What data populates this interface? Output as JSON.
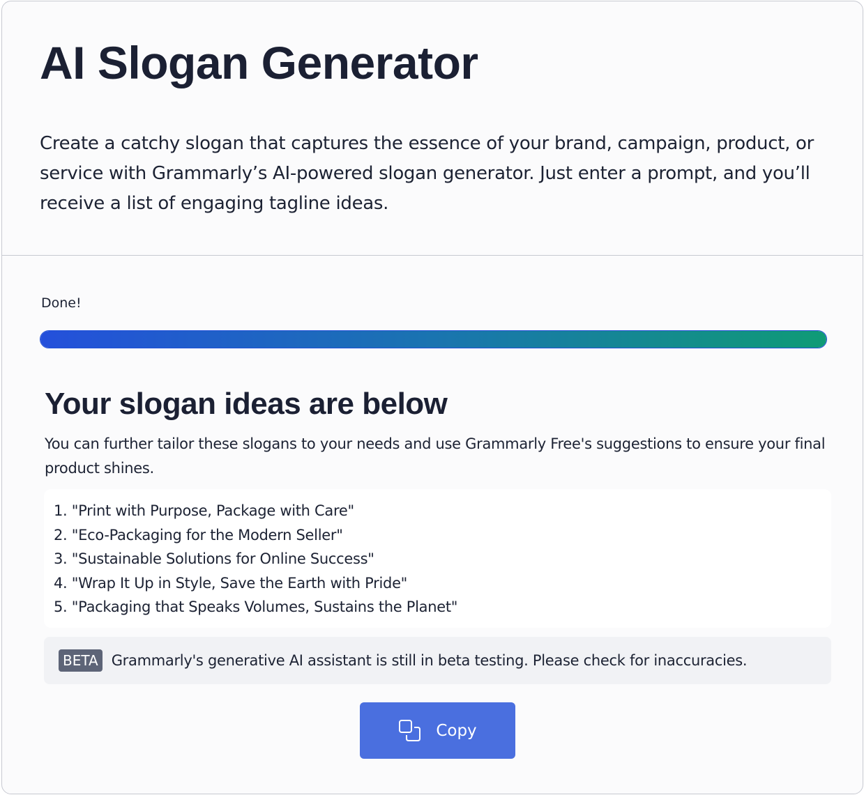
{
  "header": {
    "title": "AI Slogan Generator",
    "intro": "Create a catchy slogan that captures the essence of your brand, campaign, product, or service with Grammarly’s AI-powered slogan generator. Just enter a prompt, and you’ll receive a list of engaging tagline ideas."
  },
  "progress": {
    "status": "Done!",
    "percent": 100,
    "gradient_start": "#2450db",
    "gradient_end": "#0f9b76"
  },
  "results": {
    "title": "Your slogan ideas are below",
    "description": "You can further tailor these slogans to your needs and use Grammarly Free's suggestions to ensure your final product shines.",
    "slogans": [
      "1. \"Print with Purpose, Package with Care\"",
      "2. \"Eco-Packaging for the Modern Seller\"",
      "3. \"Sustainable Solutions for Online Success\"",
      "4. \"Wrap It Up in Style, Save the Earth with Pride\"",
      "5. \"Packaging that Speaks Volumes, Sustains the Planet\""
    ]
  },
  "beta": {
    "badge": "BETA",
    "text": "Grammarly's generative AI assistant is still in beta testing. Please check for inaccuracies."
  },
  "actions": {
    "copy_label": "Copy",
    "copy_icon": "copy-icon",
    "button_color": "#4a6fdf"
  }
}
